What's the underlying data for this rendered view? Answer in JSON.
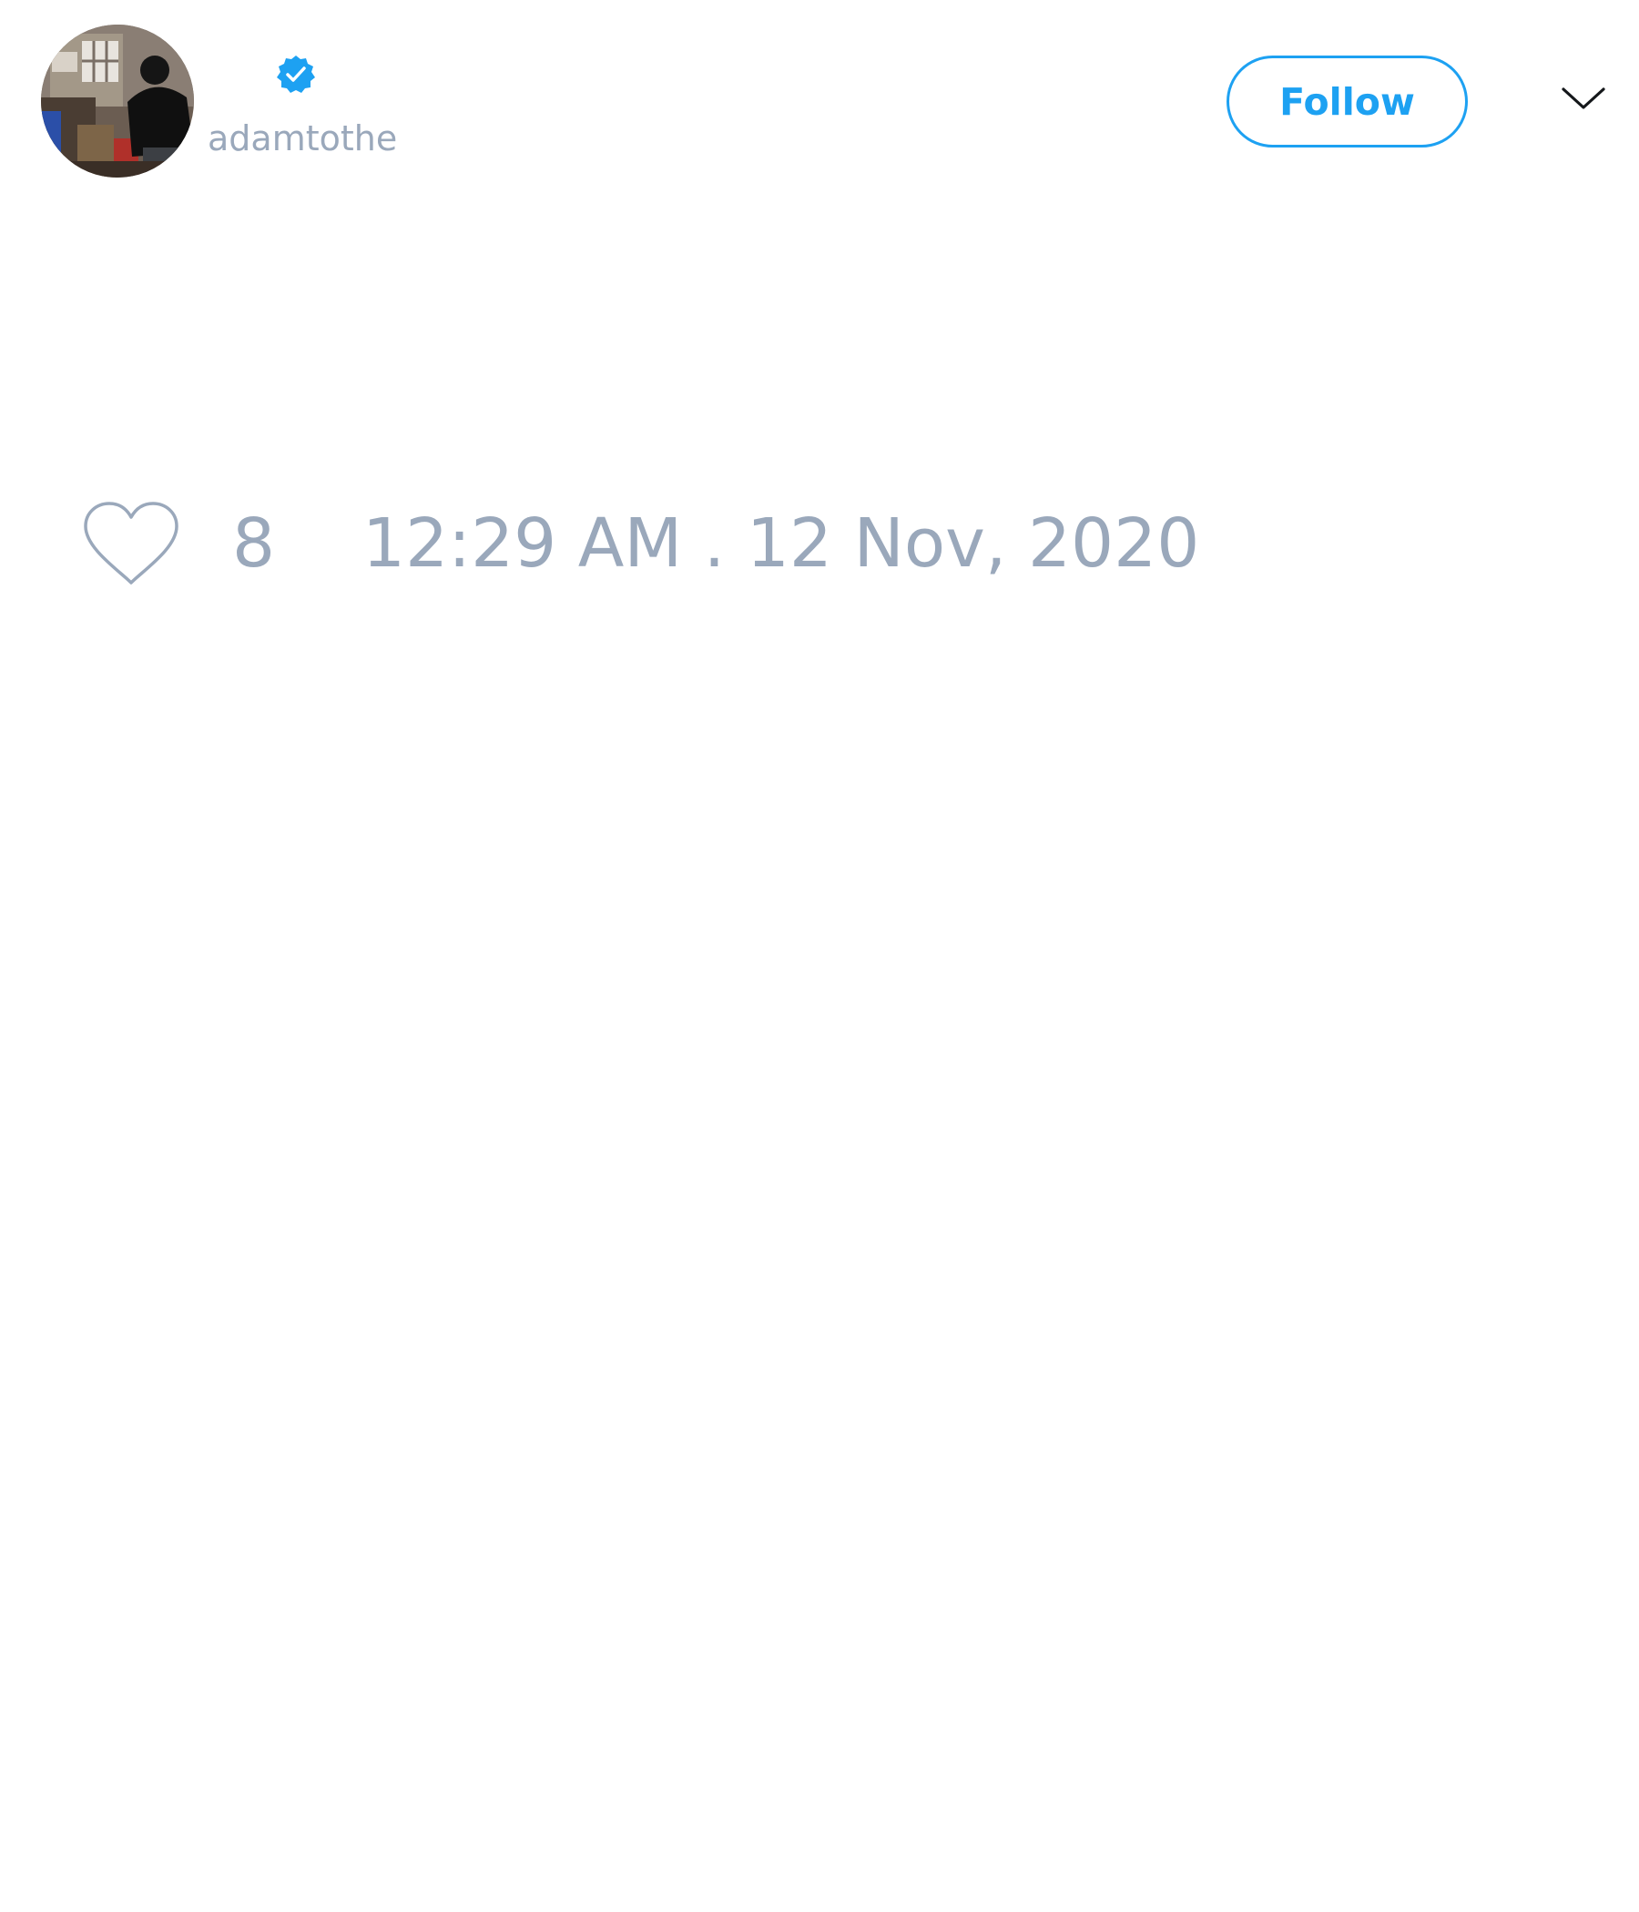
{
  "tweet": {
    "author": {
      "display_name": "",
      "handle": "adamtothe",
      "verified": true,
      "avatar_icon": "user-avatar-photo"
    },
    "actions": {
      "follow_label": "Follow",
      "menu_icon": "chevron-down-icon"
    },
    "text": "",
    "footer": {
      "like_icon": "heart-outline-icon",
      "like_count": "8",
      "timestamp": "12:29 AM . 12 Nov, 2020"
    }
  },
  "colors": {
    "accent": "#1da1f2",
    "muted_text": "#9aa8bb",
    "background": "#ffffff",
    "icon_stroke": "#9aa8bb",
    "chevron_stroke": "#14171a"
  }
}
